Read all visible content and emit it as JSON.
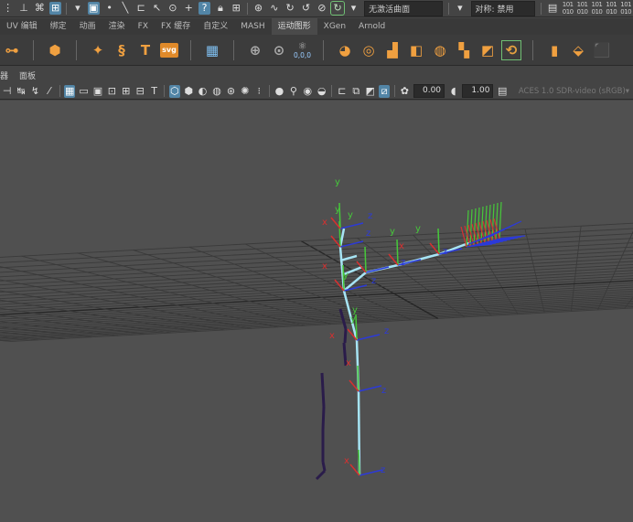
{
  "status_line": {
    "selection_mask_label": "无激活曲面",
    "symmetry_label": "对称: 禁用",
    "icons": [
      "hierarchy-icon",
      "object-icon",
      "component-icon",
      "select-tool-icon",
      "point-icon",
      "curve-icon",
      "surface-icon",
      "lasso-icon",
      "plus-icon",
      "help-icon",
      "lock-icon",
      "snap-grid-icon",
      "snap-curve-icon",
      "snap-point-icon",
      "snap-view-icon",
      "snap-live-icon"
    ]
  },
  "shelf_tabs": [
    "UV 编辑",
    "绑定",
    "动画",
    "渲染",
    "FX",
    "FX 缓存",
    "自定义",
    "MASH",
    "运动图形",
    "XGen",
    "Arnold"
  ],
  "shelf_icons": [
    "motion-trail-icon",
    "polygon-sphere-icon",
    "sparkle-icon",
    "sweep-icon",
    "text-tool-icon",
    "svg-tool-icon",
    "grid-layout-icon",
    "pivot-icon",
    "transform-reset-icon",
    "zero-transform-icon",
    "mash-network-icon",
    "mash-repro-icon",
    "mash-distribute-icon",
    "mash-blend-icon",
    "mash-dynamics-icon",
    "mash-grid-icon",
    "mash-merge-icon",
    "mash-instancer-icon",
    "mash-box-icon",
    "mash-cube-icon",
    "mash-multi-cube-icon"
  ],
  "shelf_svg_label": "svg",
  "origin_label": "0,0,0",
  "panel_menu": {
    "left_fragment": "器",
    "panels": "面板"
  },
  "panel_toolbar": {
    "exposure": "0.00",
    "gamma": "1.00",
    "color_space": "ACES 1.0 SDR-video (sRGB)"
  },
  "viewport": {
    "axis_label_y": "y",
    "axis_label_z": "z",
    "axis_label_x": "x"
  },
  "colors": {
    "viewport_bg": "#505050",
    "grid_line": "#3a3a3a",
    "grid_axis": "#262626",
    "joint_blue": "#2c3ad8",
    "joint_green": "#46c83a",
    "joint_red": "#d83030",
    "bone_cyan": "#a6e4f4",
    "bone_dark": "#2a1c4a"
  }
}
